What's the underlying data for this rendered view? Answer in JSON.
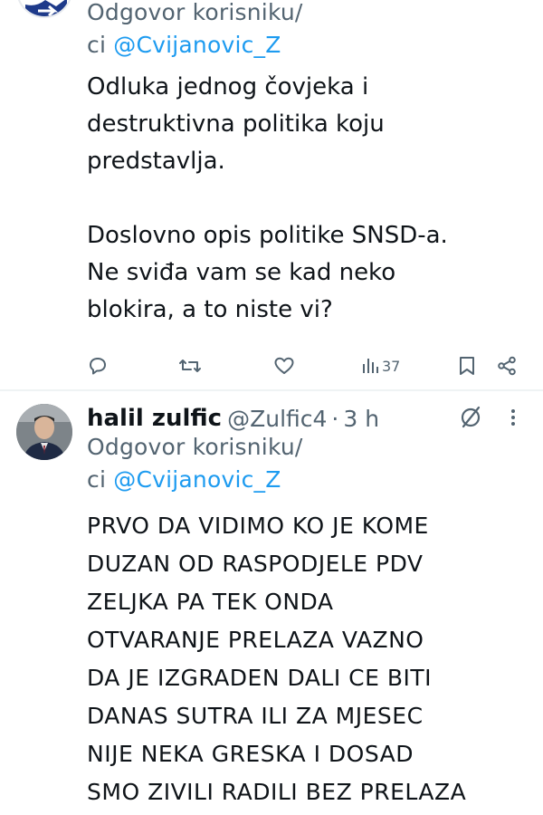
{
  "tweets": [
    {
      "reply_prefix": "Odgovor korisniku/",
      "reply_prefix_cont": "ci ",
      "reply_mention": "@Cvijanovic_Z",
      "text_lines": [
        "Odluka jednog čovjeka i",
        "destruktivna politika koju",
        "predstavlja.",
        "",
        "Doslovno opis politike SNSD-a.",
        "Ne sviđa vam se kad neko",
        "blokira, a to niste vi?"
      ],
      "views": "37"
    },
    {
      "author_name": "halil zulfic",
      "author_handle": "@Zulfic4",
      "separator": "·",
      "time": "3 h",
      "reply_prefix": "Odgovor korisniku/",
      "reply_prefix_cont": "ci ",
      "reply_mention": "@Cvijanovic_Z",
      "text_lines": [
        "PRVO DA VIDIMO KO JE KOME",
        "DUZAN OD RASPODJELE PDV",
        "ZELJKA PA TEK ONDA",
        "OTVARANJE PRELAZA VAZNO",
        "DA JE IZGRADEN DALI CE BITI",
        "DANAS SUTRA ILI ZA MJESEC",
        "NIJE NEKA GRESKA I DOSAD",
        "SMO ZIVILI RADILI BEZ PRELAZA"
      ]
    }
  ],
  "colors": {
    "text": "#0f1419",
    "secondary": "#536471",
    "link": "#1d9bf0",
    "divider": "#eff3f4"
  },
  "icons": {
    "reply": "reply-icon",
    "retweet": "retweet-icon",
    "like": "like-icon",
    "views": "views-icon",
    "bookmark": "bookmark-icon",
    "share": "share-icon",
    "grok": "grok-icon",
    "more": "more-icon"
  }
}
